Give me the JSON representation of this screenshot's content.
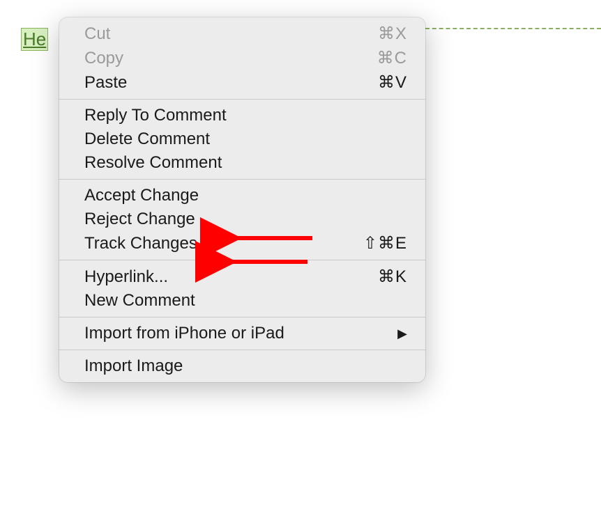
{
  "document": {
    "tracked_text": "He"
  },
  "menu": {
    "cut": {
      "label": "Cut",
      "shortcut": "⌘X"
    },
    "copy": {
      "label": "Copy",
      "shortcut": "⌘C"
    },
    "paste": {
      "label": "Paste",
      "shortcut": "⌘V"
    },
    "reply_comment": {
      "label": "Reply To Comment"
    },
    "delete_comment": {
      "label": "Delete Comment"
    },
    "resolve_comment": {
      "label": "Resolve Comment"
    },
    "accept_change": {
      "label": "Accept Change"
    },
    "reject_change": {
      "label": "Reject Change"
    },
    "track_changes": {
      "label": "Track Changes",
      "shortcut": "⇧⌘E"
    },
    "hyperlink": {
      "label": "Hyperlink...",
      "shortcut": "⌘K"
    },
    "new_comment": {
      "label": "New Comment"
    },
    "import_device": {
      "label": "Import from iPhone or iPad"
    },
    "import_image": {
      "label": "Import Image"
    }
  }
}
